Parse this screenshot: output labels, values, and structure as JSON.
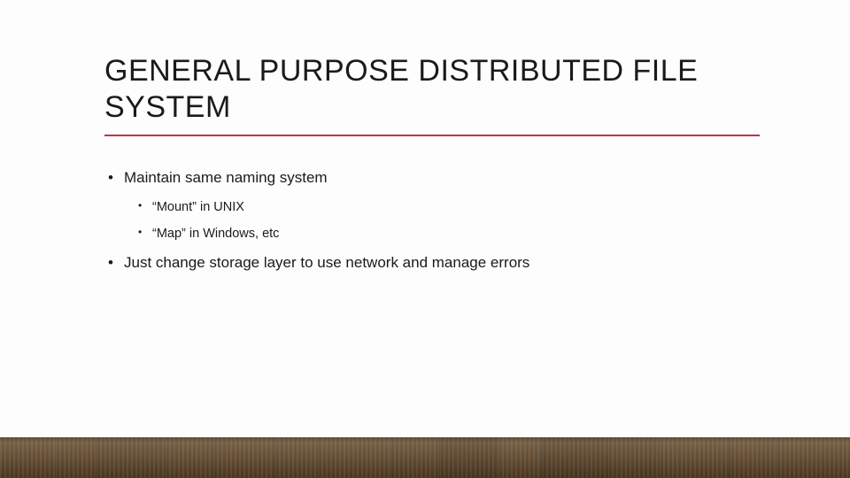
{
  "title": "GENERAL PURPOSE DISTRIBUTED FILE SYSTEM",
  "bullets": {
    "b0": "Maintain same naming system",
    "b0_0": "“Mount” in UNIX",
    "b0_1": "“Map” in Windows, etc",
    "b1": "Just change storage layer to use network and manage errors"
  },
  "plank_widths": [
    62,
    46,
    78,
    54,
    70,
    48,
    82,
    56,
    66,
    50,
    74,
    58,
    80,
    52,
    84
  ]
}
